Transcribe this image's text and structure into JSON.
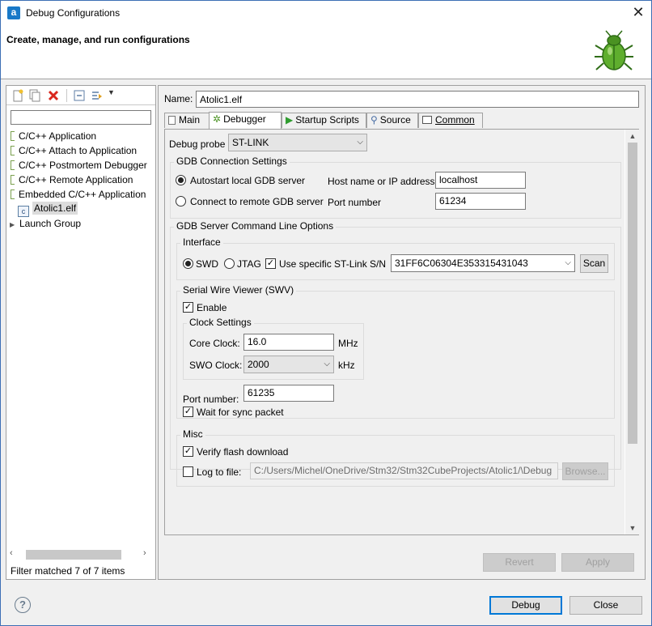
{
  "window": {
    "title": "Debug Configurations",
    "close_glyph": "✕"
  },
  "header": {
    "title": "Create, manage, and run configurations"
  },
  "left": {
    "filter_value": "",
    "tree": [
      {
        "label": "C/C++ Application",
        "icon": "config-type-icon"
      },
      {
        "label": "C/C++ Attach to Application",
        "icon": "config-type-icon"
      },
      {
        "label": "C/C++ Postmortem Debugger",
        "icon": "config-type-icon"
      },
      {
        "label": "C/C++ Remote Application",
        "icon": "config-type-icon"
      },
      {
        "label": "Embedded C/C++ Application",
        "icon": "config-type-icon"
      },
      {
        "label": "Atolic1.elf",
        "icon": "c-file-icon",
        "selected": true
      },
      {
        "label": "Launch Group",
        "icon": "expand-arrow-icon"
      }
    ],
    "status": "Filter matched 7 of 7 items"
  },
  "right": {
    "name_label": "Name:",
    "name_value": "Atolic1.elf",
    "tabs": [
      "Main",
      "Debugger",
      "Startup Scripts",
      "Source",
      "Common"
    ],
    "active_tab": "Debugger",
    "debug_probe_label": "Debug probe",
    "debug_probe_value": "ST-LINK",
    "gdb_conn": {
      "title": "GDB Connection Settings",
      "autostart_label": "Autostart local GDB server",
      "remote_label": "Connect to remote GDB server",
      "host_label": "Host name or IP address",
      "host_value": "localhost",
      "port_label": "Port number",
      "port_value": "61234"
    },
    "gdb_server": {
      "title": "GDB Server Command Line Options",
      "interface": {
        "title": "Interface",
        "swd_label": "SWD",
        "jtag_label": "JTAG",
        "use_sn_label": "Use specific ST-Link S/N",
        "sn_value": "31FF6C06304E353315431043",
        "scan_label": "Scan"
      },
      "swv": {
        "title": "Serial Wire Viewer (SWV)",
        "enable_label": "Enable",
        "clock": {
          "title": "Clock Settings",
          "core_label": "Core Clock:",
          "core_value": "16.0",
          "core_unit": "MHz",
          "swo_label": "SWO Clock:",
          "swo_value": "2000",
          "swo_unit": "kHz"
        },
        "port_label": "Port number:",
        "port_value": "61235",
        "wait_label": "Wait for sync packet"
      },
      "misc": {
        "title": "Misc",
        "verify_label": "Verify flash download",
        "log_label": "Log to file:",
        "log_value": "C:/Users/Michel/OneDrive/Stm32/Stm32CubeProjects/Atolic1/\\Debug",
        "browse_label": "Browse..."
      }
    },
    "revert_label": "Revert",
    "apply_label": "Apply"
  },
  "footer": {
    "debug_label": "Debug",
    "close_label": "Close",
    "help_glyph": "?"
  }
}
